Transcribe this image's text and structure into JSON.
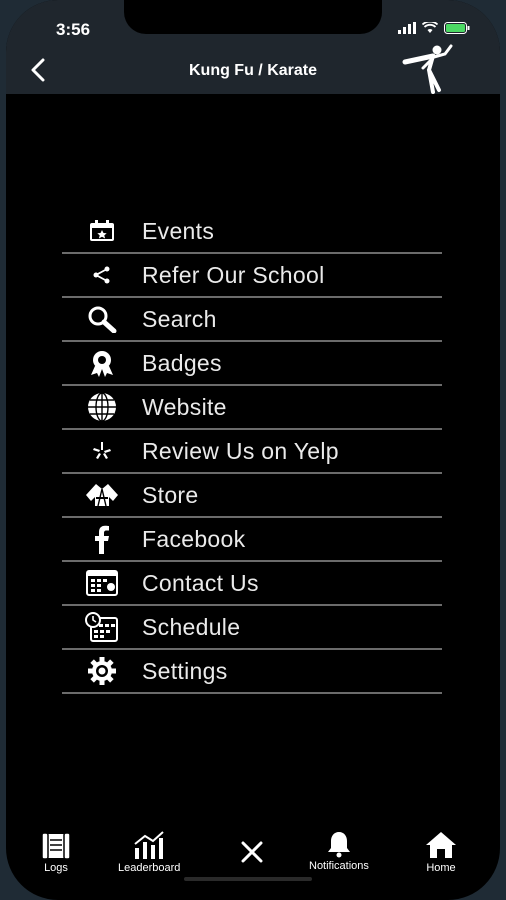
{
  "status": {
    "time": "3:56"
  },
  "header": {
    "title": "Kung Fu / Karate"
  },
  "menu": {
    "items": [
      {
        "label": "Events",
        "icon": "calendar-icon"
      },
      {
        "label": "Refer Our School",
        "icon": "share-icon"
      },
      {
        "label": "Search",
        "icon": "search-icon"
      },
      {
        "label": "Badges",
        "icon": "badge-icon"
      },
      {
        "label": "Website",
        "icon": "globe-icon"
      },
      {
        "label": "Review Us on Yelp",
        "icon": "yelp-icon"
      },
      {
        "label": "Store",
        "icon": "uniform-icon"
      },
      {
        "label": "Facebook",
        "icon": "facebook-icon"
      },
      {
        "label": "Contact Us",
        "icon": "contact-card-icon"
      },
      {
        "label": "Schedule",
        "icon": "schedule-icon"
      },
      {
        "label": "Settings",
        "icon": "gear-icon"
      }
    ]
  },
  "tabbar": {
    "logs": "Logs",
    "leaderboard": "Leaderboard",
    "notifications": "Notifications",
    "home": "Home"
  },
  "colors": {
    "header_bg": "#1f262d",
    "page_bg": "#000000",
    "divider": "#6b6b6b",
    "battery": "#4cd964"
  }
}
